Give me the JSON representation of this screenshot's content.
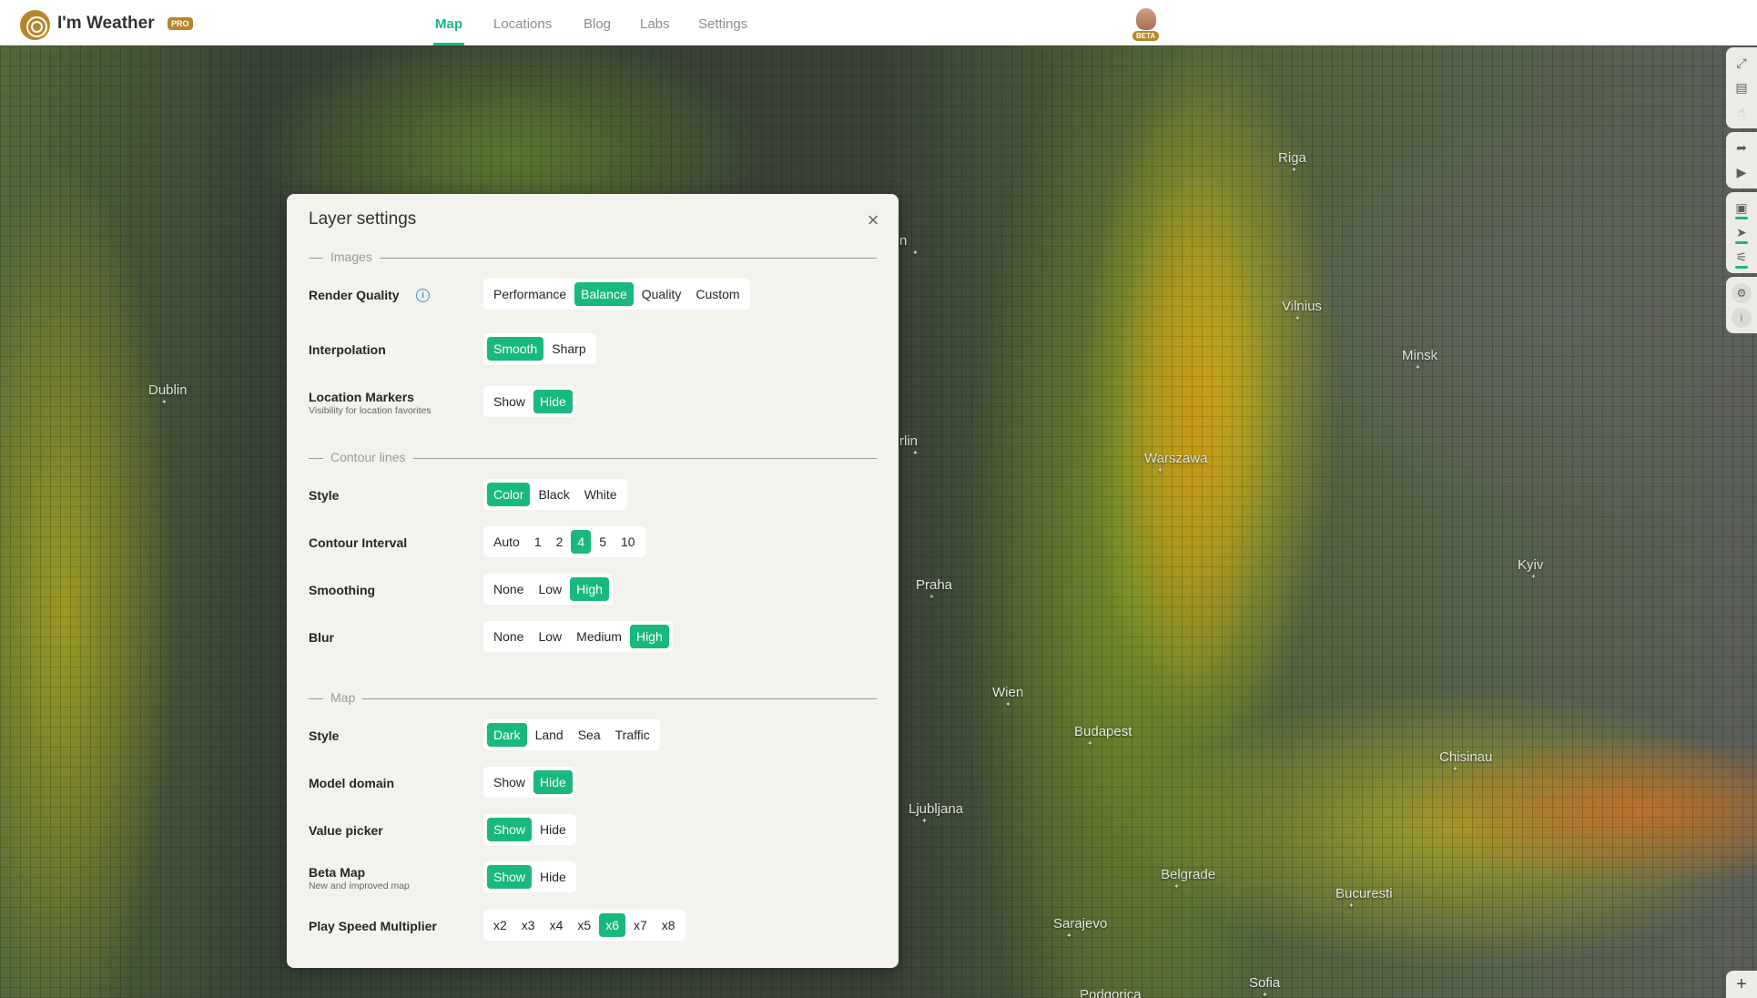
{
  "app": {
    "brand": "I'm Weather",
    "pro_badge": "PRO",
    "beta_badge": "BETA"
  },
  "nav": {
    "map": "Map",
    "locations": "Locations",
    "blog": "Blog",
    "labs": "Labs",
    "settings": "Settings"
  },
  "map_cities": {
    "riga": "Riga",
    "vilnius": "Vilnius",
    "minsk": "Minsk",
    "dublin": "Dublin",
    "warszawa": "Warszawa",
    "berlin": "rlin",
    "praha": "Praha",
    "kyiv": "Kyiv",
    "wien": "Wien",
    "budapest": "Budapest",
    "chisinau": "Chisinau",
    "ljubljana": "Ljubljana",
    "belgrade": "Belgrade",
    "bucuresti": "Bucuresti",
    "sarajevo": "Sarajevo",
    "sofia": "Sofia",
    "podgorica": "Podgorica",
    "n_label": "n"
  },
  "dialog": {
    "title": "Layer settings",
    "close": "×",
    "sections": {
      "images": "Images",
      "contour": "Contour lines",
      "map": "Map"
    },
    "render_quality": {
      "label": "Render Quality",
      "options": [
        "Performance",
        "Balance",
        "Quality",
        "Custom"
      ],
      "selected": "Balance"
    },
    "interpolation": {
      "label": "Interpolation",
      "options": [
        "Smooth",
        "Sharp"
      ],
      "selected": "Smooth"
    },
    "location_markers": {
      "label": "Location Markers",
      "sub": "Visibility for location favorites",
      "options": [
        "Show",
        "Hide"
      ],
      "selected": "Hide"
    },
    "contour_style": {
      "label": "Style",
      "options": [
        "Color",
        "Black",
        "White"
      ],
      "selected": "Color"
    },
    "contour_interval": {
      "label": "Contour Interval",
      "options": [
        "Auto",
        "1",
        "2",
        "4",
        "5",
        "10"
      ],
      "selected": "4"
    },
    "smoothing": {
      "label": "Smoothing",
      "options": [
        "None",
        "Low",
        "High"
      ],
      "selected": "High"
    },
    "blur": {
      "label": "Blur",
      "options": [
        "None",
        "Low",
        "Medium",
        "High"
      ],
      "selected": "High"
    },
    "map_style": {
      "label": "Style",
      "options": [
        "Dark",
        "Land",
        "Sea",
        "Traffic"
      ],
      "selected": "Dark"
    },
    "model_domain": {
      "label": "Model domain",
      "options": [
        "Show",
        "Hide"
      ],
      "selected": "Hide"
    },
    "value_picker": {
      "label": "Value picker",
      "options": [
        "Show",
        "Hide"
      ],
      "selected": "Show"
    },
    "beta_map": {
      "label": "Beta Map",
      "sub": "New and improved map",
      "options": [
        "Show",
        "Hide"
      ],
      "selected": "Show"
    },
    "play_speed": {
      "label": "Play Speed Multiplier",
      "options": [
        "x2",
        "x3",
        "x4",
        "x5",
        "x6",
        "x7",
        "x8"
      ],
      "selected": "x6"
    }
  },
  "toolbar": {
    "icons": [
      "fullscreen-icon",
      "notes-icon",
      "pointer-off-icon",
      "share-icon",
      "record-icon",
      "image-layer-icon",
      "send-icon",
      "chart-icon",
      "gear-icon",
      "info-icon"
    ],
    "zoom_in": "+"
  },
  "colors": {
    "accent": "#19b87f",
    "brand": "#b7862b",
    "panel": "#f3f2ed"
  }
}
